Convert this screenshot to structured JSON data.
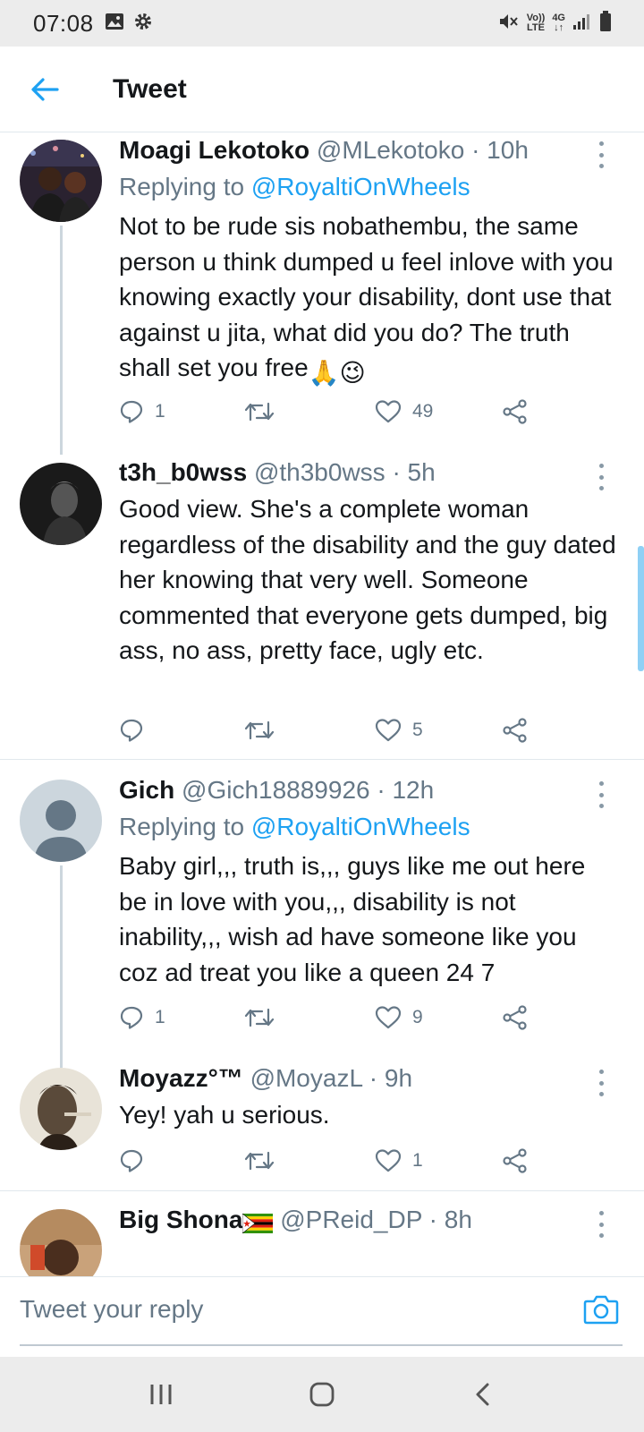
{
  "status_bar": {
    "time": "07:08",
    "volte_top": "Vo))",
    "volte_bottom": "LTE",
    "network": "4G",
    "network_arrows": "↓↑"
  },
  "header": {
    "title": "Tweet"
  },
  "tweets": [
    {
      "name": "Moagi Lekotoko",
      "handle": "@MLekotoko",
      "time": "· 10h",
      "replying_label": "Replying to",
      "replying_to": "@RoyaltiOnWheels",
      "text": "Not to be rude sis nobathembu, the same person u think dumped u feel inlove with you knowing exactly your disability, dont use that against u jita, what did you do? The truth shall set you free",
      "emoji": "🙏😉",
      "replies": "1",
      "retweets": "",
      "likes": "49"
    },
    {
      "name": "t3h_b0wss",
      "handle": "@th3b0wss",
      "time": "· 5h",
      "text": "Good view. She's a complete woman regardless of the disability and the guy dated her knowing that very well. Someone commented that everyone gets dumped, big ass, no ass, pretty face, ugly etc.",
      "replies": "",
      "retweets": "",
      "likes": "5"
    },
    {
      "name": "Gich",
      "handle": "@Gich18889926",
      "time": "· 12h",
      "replying_label": "Replying to",
      "replying_to": "@RoyaltiOnWheels",
      "text": "Baby girl,,, truth is,,, guys like me out here be in love with you,,, disability is not inability,,, wish ad have someone like you coz ad treat you like a queen 24 7",
      "replies": "1",
      "retweets": "",
      "likes": "9"
    },
    {
      "name": "Moyazz°™",
      "handle": "@MoyazL",
      "time": "· 9h",
      "text": "Yey! yah u serious.",
      "replies": "",
      "retweets": "",
      "likes": "1"
    },
    {
      "name": "Big Shona",
      "handle": "@PReid_DP",
      "time": "· 8h"
    }
  ],
  "reply_bar": {
    "placeholder": "Tweet your reply"
  },
  "colors": {
    "accent": "#1da1f2",
    "secondary_text": "#657786",
    "primary_text": "#14171a"
  },
  "icons": [
    "back-arrow-icon",
    "reply-icon",
    "retweet-icon",
    "like-icon",
    "share-icon",
    "more-icon",
    "camera-icon",
    "recents-icon",
    "home-icon",
    "back-icon"
  ]
}
